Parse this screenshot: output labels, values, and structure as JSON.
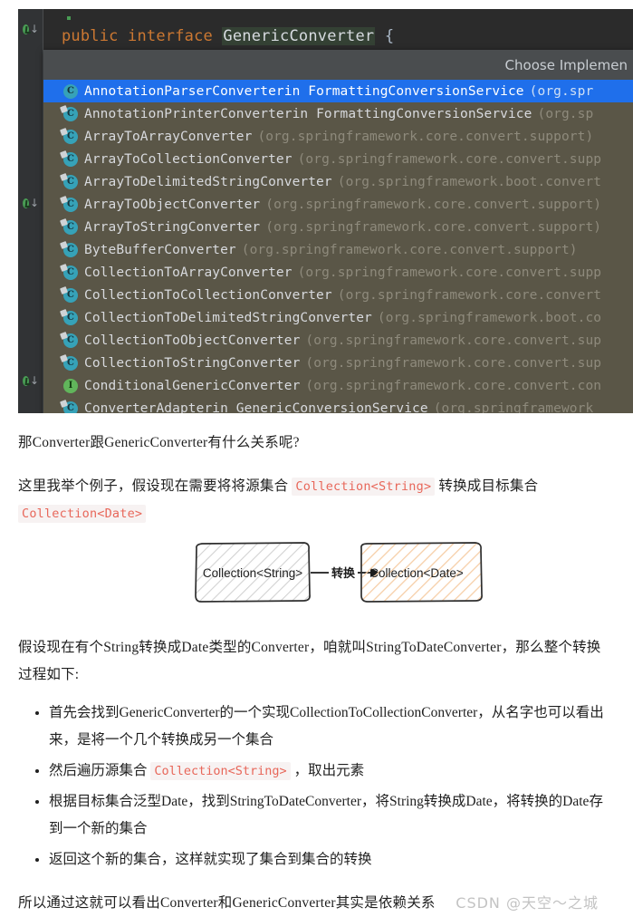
{
  "ide": {
    "code_line": {
      "kw1": "public",
      "kw2": "interface",
      "class_name": "GenericConverter",
      "brace": "{"
    },
    "popup": {
      "header": "Choose Implemen",
      "rows": [
        {
          "icon": "class-icon",
          "icon_letter": "C",
          "name": "AnnotationParserConverter",
          "in": " in FormattingConversionService",
          "pkg": "(org.spr",
          "selected": true
        },
        {
          "icon": "class-icon",
          "icon_letter": "C",
          "name": "AnnotationPrinterConverter",
          "in": " in FormattingConversionService",
          "pkg": "(org.sp",
          "selected": false
        },
        {
          "icon": "class-icon",
          "icon_letter": "C",
          "name": "ArrayToArrayConverter",
          "in": "",
          "pkg": "(org.springframework.core.convert.support)",
          "selected": false
        },
        {
          "icon": "class-icon",
          "icon_letter": "C",
          "name": "ArrayToCollectionConverter",
          "in": "",
          "pkg": "(org.springframework.core.convert.supp",
          "selected": false
        },
        {
          "icon": "class-icon",
          "icon_letter": "C",
          "name": "ArrayToDelimitedStringConverter",
          "in": "",
          "pkg": "(org.springframework.boot.convert",
          "selected": false
        },
        {
          "icon": "class-icon",
          "icon_letter": "C",
          "name": "ArrayToObjectConverter",
          "in": "",
          "pkg": "(org.springframework.core.convert.support)",
          "selected": false
        },
        {
          "icon": "class-icon",
          "icon_letter": "C",
          "name": "ArrayToStringConverter",
          "in": "",
          "pkg": "(org.springframework.core.convert.support)",
          "selected": false
        },
        {
          "icon": "class-icon",
          "icon_letter": "C",
          "name": "ByteBufferConverter",
          "in": "",
          "pkg": "(org.springframework.core.convert.support)",
          "selected": false
        },
        {
          "icon": "class-icon",
          "icon_letter": "C",
          "name": "CollectionToArrayConverter",
          "in": "",
          "pkg": "(org.springframework.core.convert.supp",
          "selected": false
        },
        {
          "icon": "class-icon",
          "icon_letter": "C",
          "name": "CollectionToCollectionConverter",
          "in": "",
          "pkg": "(org.springframework.core.convert",
          "selected": false
        },
        {
          "icon": "class-icon",
          "icon_letter": "C",
          "name": "CollectionToDelimitedStringConverter",
          "in": "",
          "pkg": "(org.springframework.boot.co",
          "selected": false
        },
        {
          "icon": "class-icon",
          "icon_letter": "C",
          "name": "CollectionToObjectConverter",
          "in": "",
          "pkg": "(org.springframework.core.convert.sup",
          "selected": false
        },
        {
          "icon": "class-icon",
          "icon_letter": "C",
          "name": "CollectionToStringConverter",
          "in": "",
          "pkg": "(org.springframework.core.convert.sup",
          "selected": false
        },
        {
          "icon": "interface-icon",
          "icon_letter": "I",
          "name": "ConditionalGenericConverter",
          "in": "",
          "pkg": "(org.springframework.core.convert.con",
          "selected": false
        },
        {
          "icon": "class-icon",
          "icon_letter": "C",
          "name": "ConverterAdapter",
          "in": " in GenericConversionService",
          "pkg": "(org.springframework",
          "selected": false
        }
      ]
    }
  },
  "article": {
    "p1": "那Converter跟GenericConverter有什么关系呢?",
    "p2_a": "这里我举个例子，假设现在需要将将源集合 ",
    "p2_code1": "Collection<String>",
    "p2_b": " 转换成目标集合 ",
    "p2_code2": "Collection<Date>",
    "diagram": {
      "box_left": "Collection<String>",
      "edge_label": "转换",
      "box_right": "Collection<Date>",
      "hatch_left_color": "#cccccc",
      "hatch_right_color": "#f3c9a3",
      "stroke_color": "#333333"
    },
    "p3": "假设现在有个String转换成Date类型的Converter，咱就叫StringToDateConverter，那么整个转换过程如下:",
    "bullets": [
      {
        "text_a": "首先会找到GenericConverter的一个实现CollectionToCollectionConverter，从名字也可以看出来，是将一个几个转换成另一个集合",
        "code": "",
        "text_b": ""
      },
      {
        "text_a": "然后遍历源集合 ",
        "code": "Collection<String>",
        "text_b": " ，取出元素"
      },
      {
        "text_a": "根据目标集合泛型Date，找到StringToDateConverter，将String转换成Date，将转换的Date存到一个新的集合",
        "code": "",
        "text_b": ""
      },
      {
        "text_a": "返回这个新的集合，这样就实现了集合到集合的转换",
        "code": "",
        "text_b": ""
      }
    ],
    "p4": "所以通过这就可以看出Converter和GenericConverter其实是依赖关系",
    "watermark": "CSDN @天空～之城"
  }
}
